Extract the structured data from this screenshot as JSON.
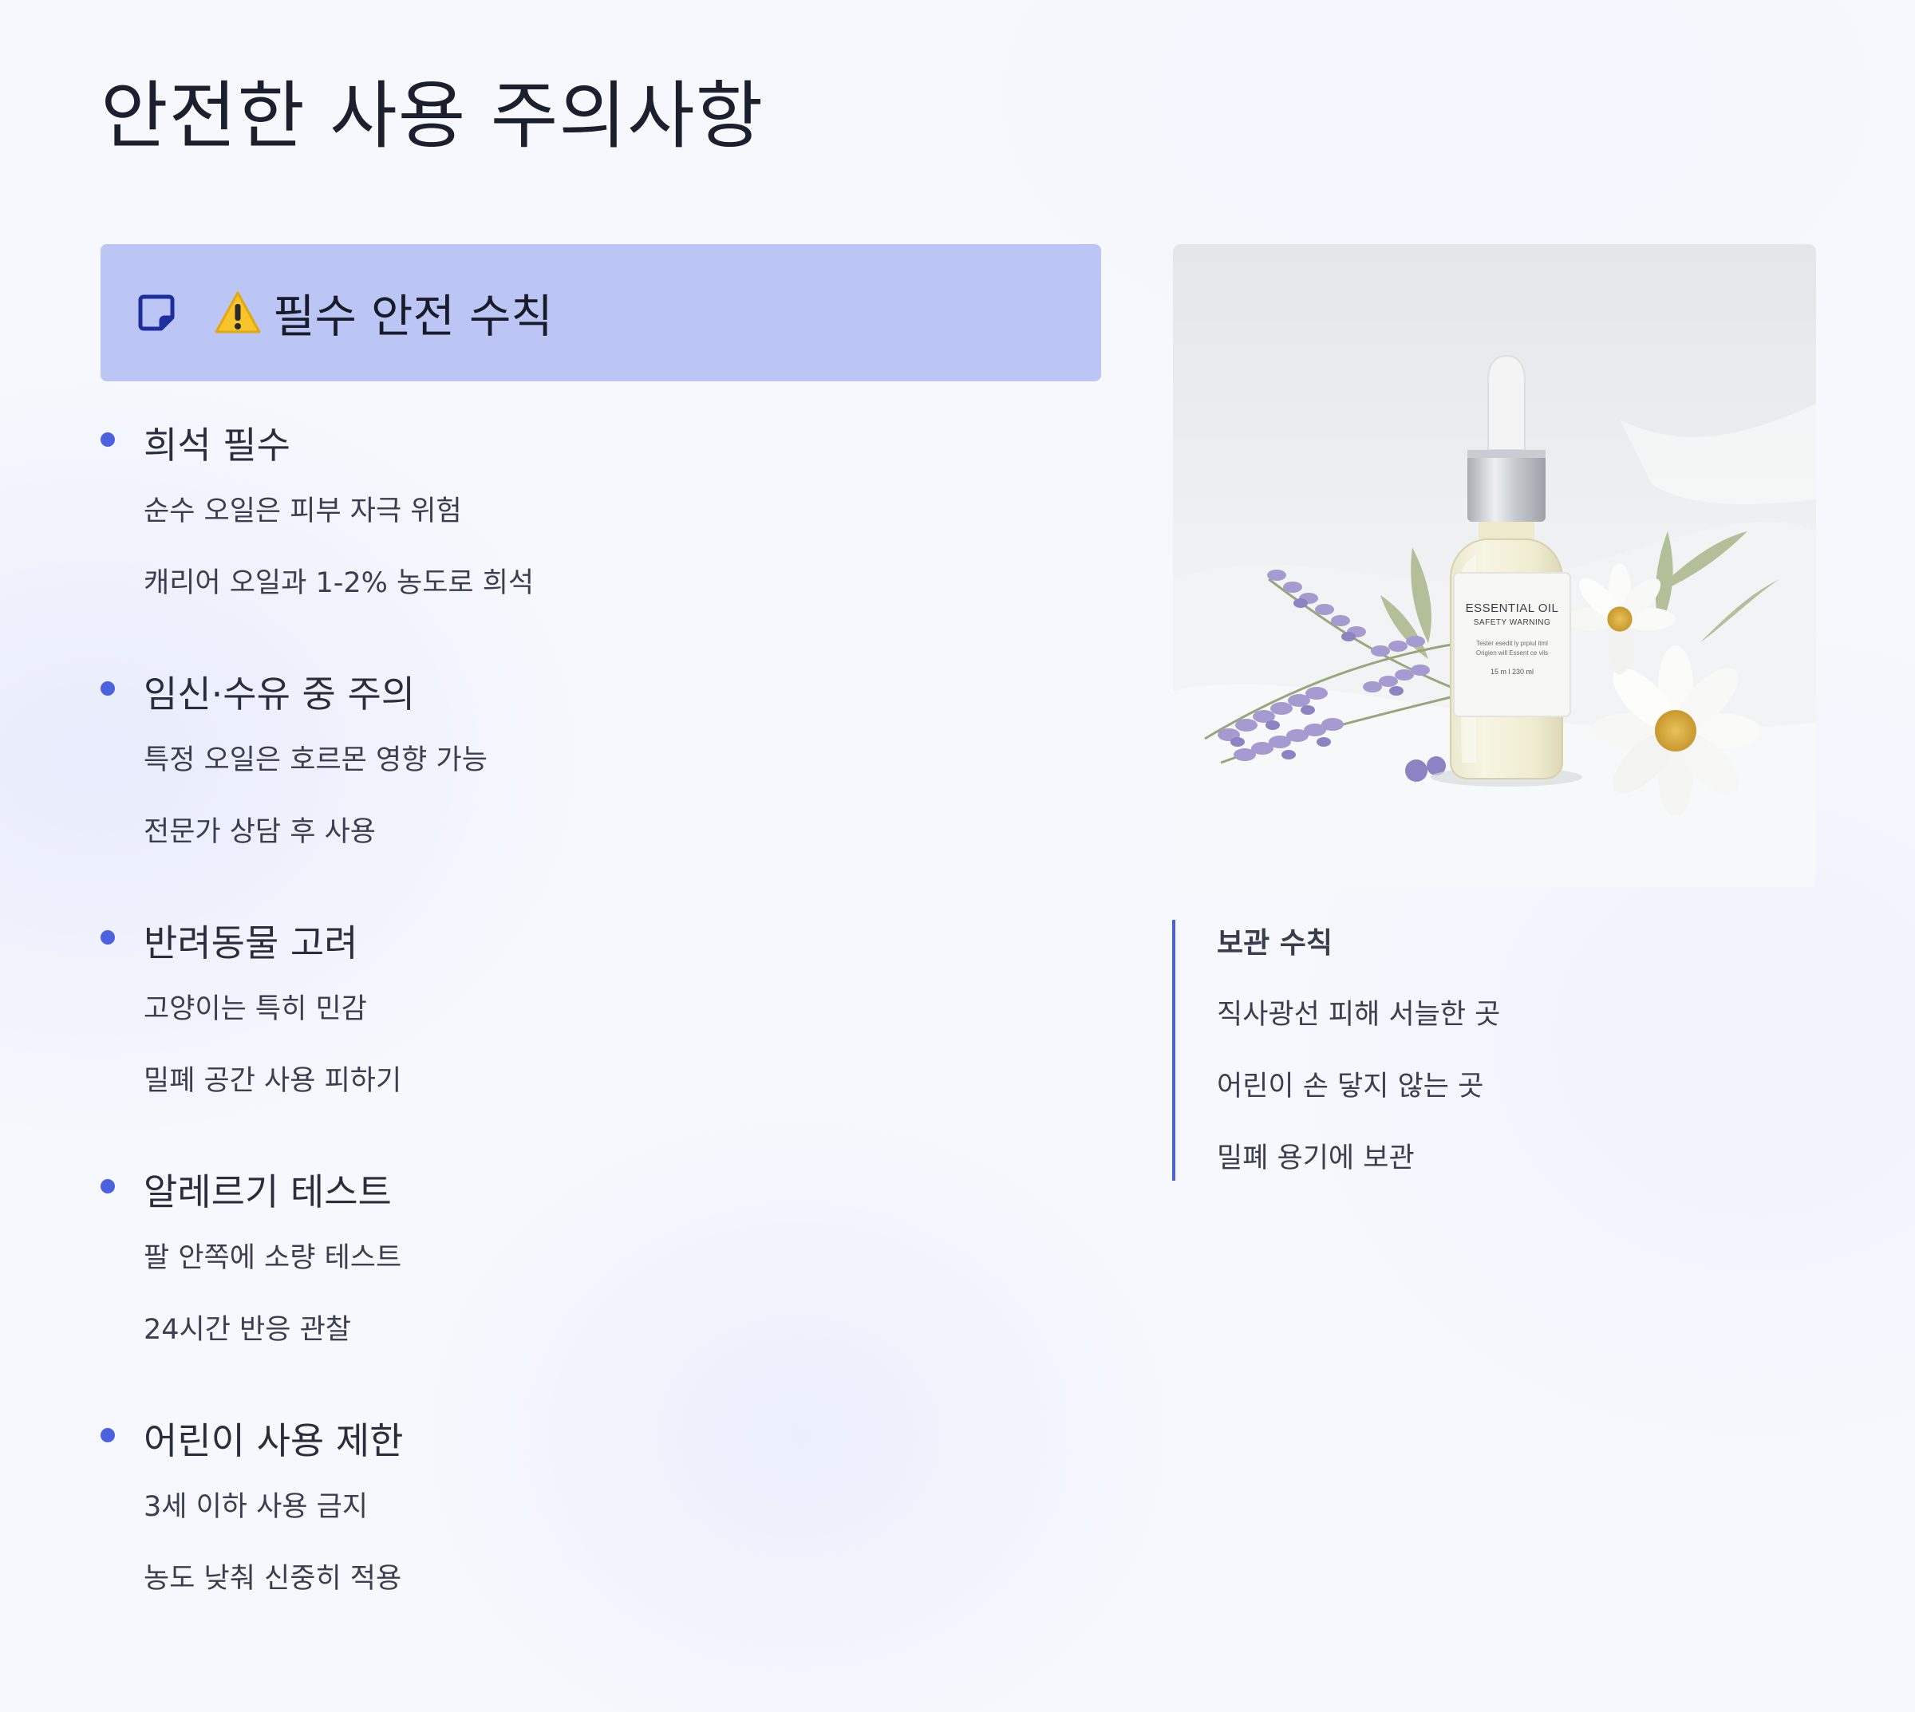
{
  "page": {
    "title": "안전한 사용 주의사항"
  },
  "callout": {
    "icon": "note-icon",
    "warning_icon": "warning-icon",
    "title": "필수 안전 수칙"
  },
  "rules": [
    {
      "heading": "희석 필수",
      "lines": [
        "순수 오일은 피부 자극 위험",
        "캐리어 오일과 1-2% 농도로 희석"
      ]
    },
    {
      "heading": "임신·수유 중 주의",
      "lines": [
        "특정 오일은 호르몬 영향 가능",
        "전문가 상담 후 사용"
      ]
    },
    {
      "heading": "반려동물 고려",
      "lines": [
        "고양이는 특히 민감",
        "밀폐 공간 사용 피하기"
      ]
    },
    {
      "heading": "알레르기 테스트",
      "lines": [
        "팔 안쪽에 소량 테스트",
        "24시간 반응 관찰"
      ]
    },
    {
      "heading": "어린이 사용 제한",
      "lines": [
        "3세 이하 사용 금지",
        "농도 낮춰 신중히 적용"
      ]
    }
  ],
  "photo": {
    "label_title": "ESSENTIAL OIL",
    "label_subtitle": "SAFETY WARNING",
    "label_text_1": "Tester esedit ly prpiul itml",
    "label_text_2": "Origien will Essent ce vils",
    "label_volume": "15 m l 230 ml"
  },
  "storage": {
    "title": "보관 수칙",
    "lines": [
      "직사광선 피해 서늘한 곳",
      "어린이 손 닿지 않는 곳",
      "밀폐 용기에 보관"
    ]
  },
  "colors": {
    "accent": "#4a61e0",
    "callout_bg": "#bcc6f4",
    "page_bg": "#f7f8fd"
  }
}
